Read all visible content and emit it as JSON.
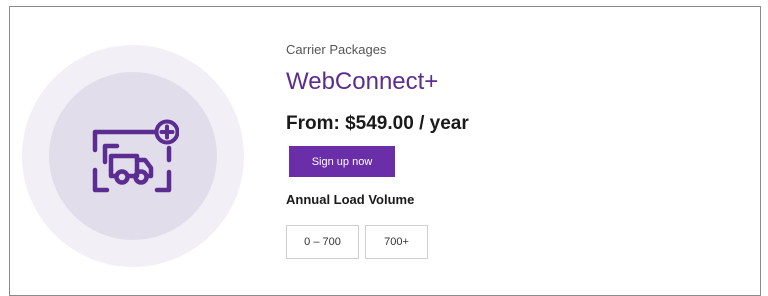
{
  "package": {
    "category": "Carrier Packages",
    "title": "WebConnect+",
    "price": "From: $549.00 / year",
    "signup_label": "Sign up now",
    "icon": "truck-plus-icon"
  },
  "volume": {
    "label": "Annual Load Volume",
    "options": [
      "0 – 700",
      "700+"
    ]
  },
  "colors": {
    "accent": "#5c2d91",
    "button": "#6a2ea8",
    "circle_outer": "#f2f0f6",
    "circle_inner": "#e2ddeb"
  }
}
